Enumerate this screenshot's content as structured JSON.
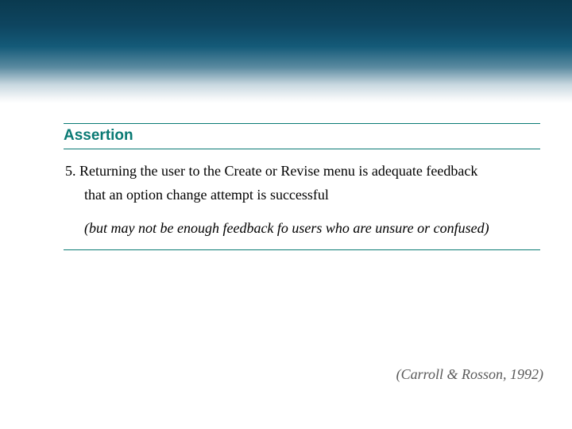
{
  "section_title": "Assertion",
  "item_number": "5.",
  "line1": "Returning the user to the Create or Revise menu is adequate feedback",
  "line2": "that an option change attempt is successful",
  "note": "(but may not be enough feedback fo users who are unsure or confused)",
  "citation": "(Carroll & Rosson,  1992)"
}
